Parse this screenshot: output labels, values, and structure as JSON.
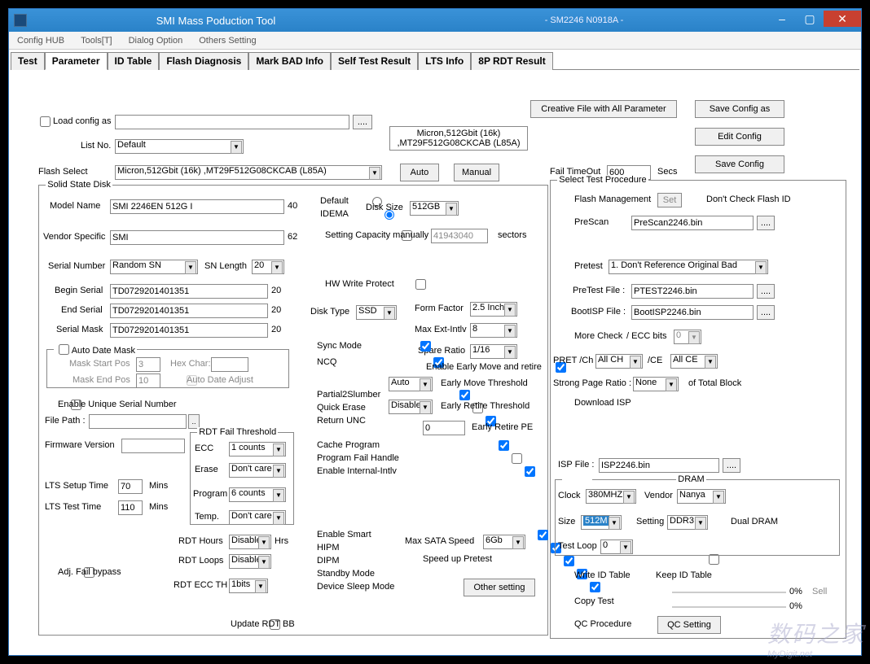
{
  "title": "SMI Mass Poduction Tool",
  "subtitle": "- SM2246 N0918A -",
  "menu": {
    "config": "Config HUB",
    "tools": "Tools[T]",
    "dialog": "Dialog Option",
    "others": "Others Setting"
  },
  "tabs": [
    "Test",
    "Parameter",
    "ID Table",
    "Flash Diagnosis",
    "Mark BAD Info",
    "Self Test Result",
    "LTS Info",
    "8P RDT Result"
  ],
  "loadConfigAs": "Load config as",
  "browse": "....",
  "listNo": "List No.",
  "listNoVal": "Default",
  "flashInfo": "Micron,512Gbit (16k) ,MT29F512G08CKCAB (L85A)",
  "flashSelect": "Flash Select",
  "flashSelectVal": "Micron,512Gbit (16k) ,MT29F512G08CKCAB (L85A)",
  "auto": "Auto",
  "manual": "Manual",
  "creativeFile": "Creative File with All Parameter",
  "saveConfigAs": "Save Config as",
  "editConfig": "Edit Config",
  "saveConfig": "Save Config",
  "failTimeout": "Fail TimeOut",
  "failTimeoutVal": "600",
  "secs": "Secs",
  "ssd": {
    "legend": "Solid State Disk",
    "modelName": "Model Name",
    "modelVal": "SMI 2246EN 512G I",
    "modelLen": "40",
    "vendorSpecific": "Vendor Specific",
    "vendorVal": "SMI",
    "vendorLen": "62",
    "serialNumber": "Serial Number",
    "snVal": "Random SN",
    "snLength": "SN Length",
    "snLenVal": "20",
    "beginSerial": "Begin Serial",
    "beginVal": "TD0729201401351",
    "beginLen": "20",
    "endSerial": "End Serial",
    "endVal": "TD0729201401351",
    "endLen": "20",
    "serialMask": "Serial Mask",
    "maskVal": "TD0729201401351",
    "maskLen": "20",
    "autoDateMask": "Auto Date Mask",
    "maskStartPos": "Mask Start Pos",
    "maskStartVal": "3",
    "hexChar": "Hex Char:",
    "maskEndPos": "Mask End Pos",
    "maskEndVal": "10",
    "autoDateAdjust": "Auto Date Adjust",
    "enableUnique": "Enable Unique Serial Number",
    "filePath": "File Path :",
    "firmwareVersion": "Firmware Version",
    "ltsSetup": "LTS Setup Time",
    "ltsSetupVal": "70",
    "mins": "Mins",
    "ltsTest": "LTS Test Time",
    "ltsTestVal": "110",
    "adjFail": "Adj. Fail bypass",
    "rdtFail": "RDT Fail Threshold",
    "ecc": "ECC",
    "eccVal": "1 counts",
    "erase": "Erase",
    "eraseVal": "Don't care",
    "program": "Program",
    "programVal": "6 counts",
    "temp": "Temp.",
    "tempVal": "Don't care",
    "rdtHours": "RDT Hours",
    "rdtHoursVal": "Disable",
    "hrs": "Hrs",
    "rdtLoops": "RDT Loops",
    "rdtLoopsVal": "Disable",
    "rdtEccTh": "RDT ECC TH",
    "rdtEccVal": "1bits",
    "updateRdtBB": "Update RDT BB",
    "default": "Default",
    "idema": "IDEMA",
    "diskSize": "Disk Size",
    "diskSizeVal": "512GB",
    "settingCap": "Setting Capacity manually",
    "settingCapVal": "41943040",
    "sectors": "sectors",
    "hwWrite": "HW Write Protect",
    "diskType": "Disk Type",
    "diskTypeVal": "SSD",
    "formFactor": "Form Factor",
    "formFactorVal": "2.5 Inch",
    "maxExt": "Max Ext-Intlv",
    "maxExtVal": "8",
    "spareRatio": "Spare Ratio",
    "spareRatioVal": "1/16",
    "syncMode": "Sync Mode",
    "ncq": "NCQ",
    "enableEarly": "Enable Early Move and retire",
    "partial2": "Partial2Slumber",
    "quickErase": "Quick Erase",
    "returnUnc": "Return UNC",
    "earlyMove": "Early Move Threshold",
    "earlyMoveVal": "Auto",
    "earlyRetire": "Early Retire Threshold",
    "earlyRetireVal": "Disable",
    "earlyPE": "Early Retire PE",
    "earlyPEVal": "0",
    "cacheProgram": "Cache Program",
    "progFail": "Program Fail Handle",
    "enableIntlv": "Enable Internal-Intlv",
    "enableSmart": "Enable Smart",
    "hipm": "HIPM",
    "dipm": "DIPM",
    "standby": "Standby Mode",
    "deviceSleep": "Device Sleep Mode",
    "maxSata": "Max SATA Speed",
    "maxSataVal": "6Gb",
    "speedUp": "Speed up Pretest",
    "otherSetting": "Other setting"
  },
  "stp": {
    "legend": "Select Test Procedure",
    "flashMgmt": "Flash Management",
    "set": "Set",
    "dontCheck": "Don't Check Flash ID",
    "prescan": "PreScan",
    "prescanVal": "PreScan2246.bin",
    "pretest": "Pretest",
    "pretestOpt": "1. Don't Reference Original Bad",
    "pretestFile": "PreTest File :",
    "pretestFileVal": "PTEST2246.bin",
    "bootisp": "BootISP File :",
    "bootispVal": "BootISP2246.bin",
    "moreCheck": "More Check",
    "eccBits": "/ ECC bits",
    "eccBitsVal": "0",
    "pretCh": "PRET /Ch",
    "pretChVal": "All CH",
    "ce": "/CE",
    "ceVal": "All CE",
    "strongPage": "Strong Page Ratio :",
    "strongVal": "None",
    "ofTotal": "of Total Block",
    "downloadIsp": "Download ISP",
    "ispFile": "ISP File :",
    "ispFileVal": "ISP2246.bin",
    "dram": "DRAM",
    "clock": "Clock",
    "clockVal": "380MHZ",
    "vendor": "Vendor",
    "vendorVal": "Nanya",
    "size": "Size",
    "sizeVal": "512M",
    "setting": "Setting",
    "settingVal": "DDR3",
    "dualDram": "Dual DRAM",
    "testLoop": "Test Loop",
    "testLoopVal": "0",
    "writeId": "Write ID Table",
    "keepId": "Keep ID Table",
    "copyTest": "Copy Test",
    "zero": "0%",
    "zero1": "0%",
    "sell": "Sell",
    "qcProc": "QC Procedure",
    "qcSetting": "QC Setting"
  },
  "watermark": {
    "cn": "数码之家",
    "en": "MyDigit.net"
  }
}
